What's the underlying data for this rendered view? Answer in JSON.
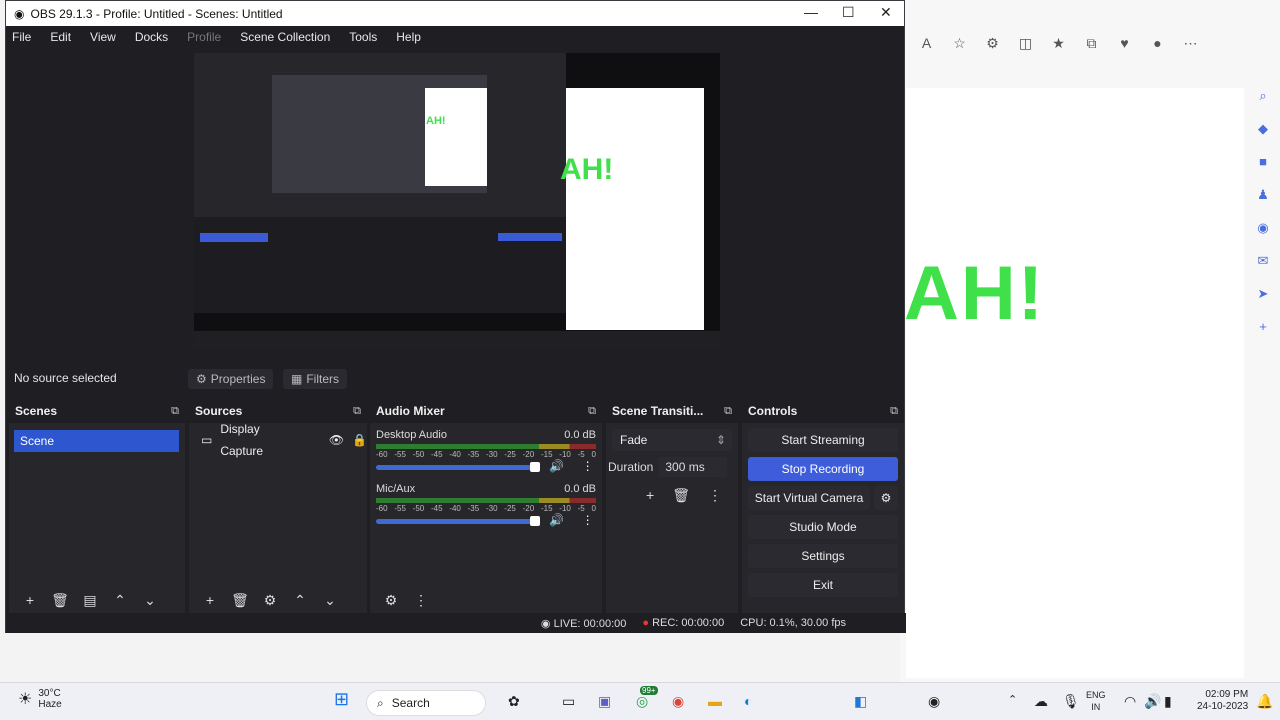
{
  "window_title": "OBS 29.1.3 - Profile: Untitled - Scenes: Untitled",
  "menu": [
    "File",
    "Edit",
    "View",
    "Docks",
    "Profile",
    "Scene Collection",
    "Tools",
    "Help"
  ],
  "status_text": "No source selected",
  "buttons": {
    "properties": "Properties",
    "filters": "Filters"
  },
  "docks": {
    "scenes": "Scenes",
    "sources": "Sources",
    "audio_mixer": "Audio Mixer",
    "transitions": "Scene Transiti...",
    "controls": "Controls"
  },
  "scenes": [
    "Scene"
  ],
  "sources": [
    "Display Capture"
  ],
  "mixer": {
    "ticks": [
      "-60",
      "-55",
      "-50",
      "-45",
      "-40",
      "-35",
      "-30",
      "-25",
      "-20",
      "-15",
      "-10",
      "-5",
      "0"
    ],
    "channels": [
      {
        "name": "Desktop Audio",
        "db": "0.0 dB"
      },
      {
        "name": "Mic/Aux",
        "db": "0.0 dB"
      }
    ]
  },
  "transition": {
    "type": "Fade",
    "duration_label": "Duration",
    "duration": "300 ms"
  },
  "controls": {
    "start_streaming": "Start Streaming",
    "stop_recording": "Stop Recording",
    "start_virtual_camera": "Start Virtual Camera",
    "studio_mode": "Studio Mode",
    "settings": "Settings",
    "exit": "Exit"
  },
  "statusbar": {
    "live": "LIVE: 00:00:00",
    "rec": "REC: 00:00:00",
    "cpu": "CPU: 0.1%, 30.00 fps"
  },
  "preview_text": "AH!",
  "taskbar": {
    "temp": "30°C",
    "weather": "Haze",
    "search": "Search",
    "lang1": "ENG",
    "lang2": "IN",
    "time": "02:09 PM",
    "date": "24-10-2023",
    "badge": "99+"
  }
}
